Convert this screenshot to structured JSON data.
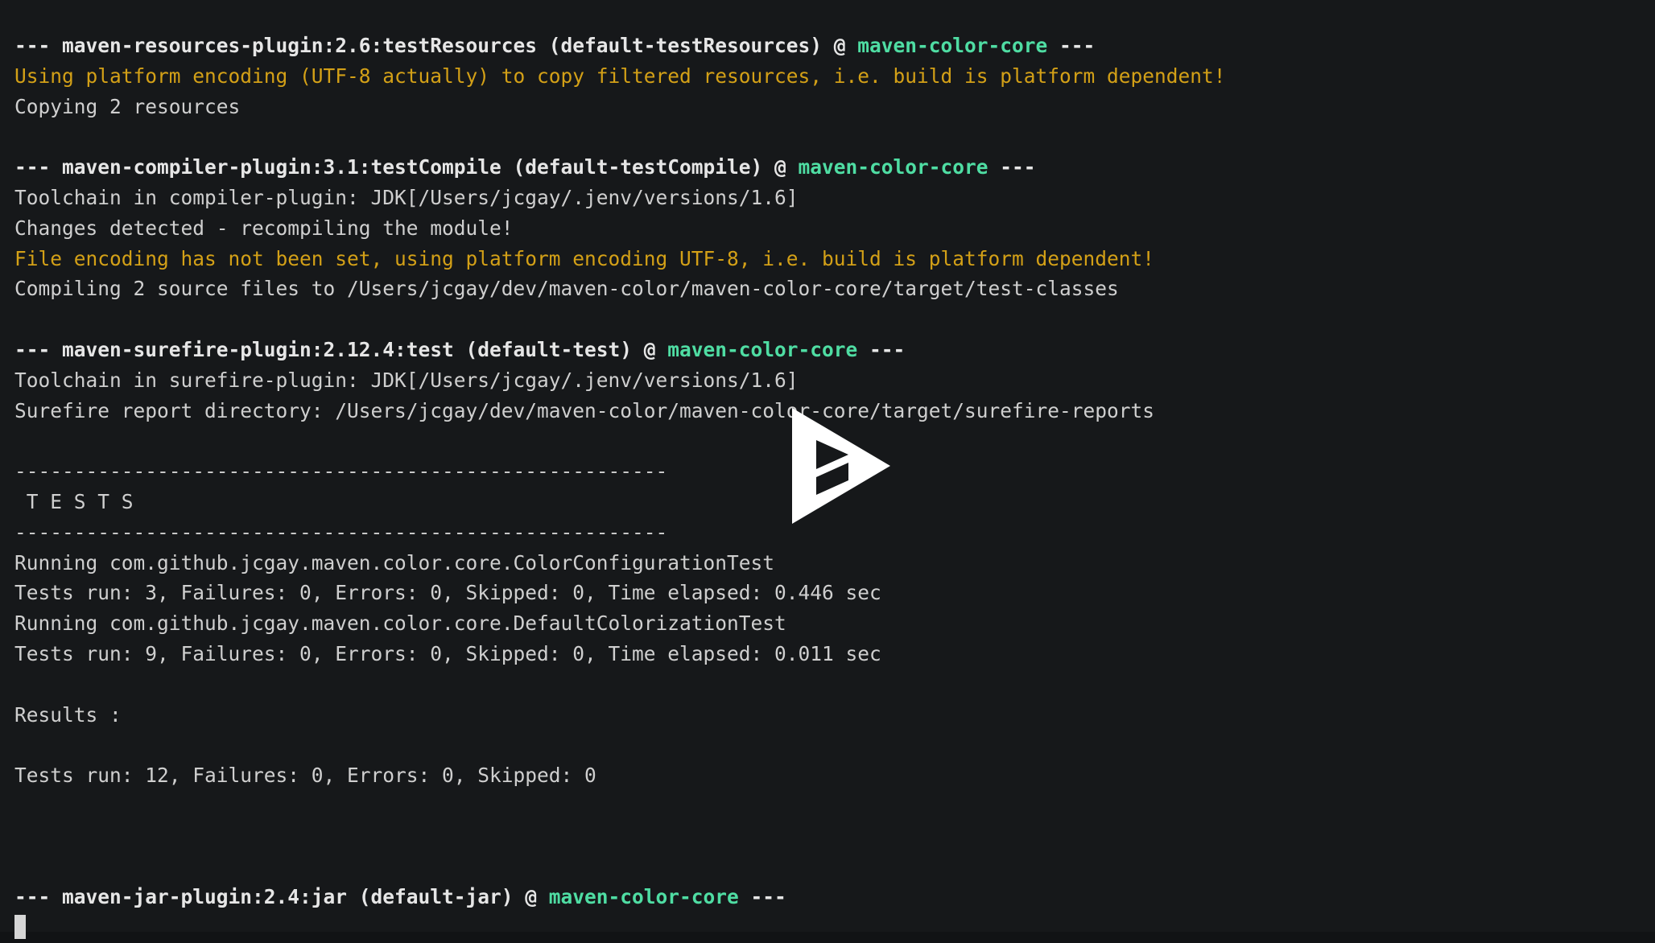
{
  "terminal": {
    "background_color": "#16181a",
    "default_text_color": "#cfcfcf",
    "warning_color": "#d3a017",
    "project_color": "#4fdda3",
    "cursor_color": "#d6d6d6",
    "lines": [
      {
        "id": "l01",
        "segments": [
          {
            "text": "--- maven-resources-plugin:2.6:testResources (default-testResources) @ ",
            "style": "bold"
          },
          {
            "text": "maven-color-core",
            "style": "project"
          },
          {
            "text": " ---",
            "style": "bold"
          }
        ]
      },
      {
        "id": "l02",
        "segments": [
          {
            "text": "Using platform encoding (UTF-8 actually) to copy filtered resources, i.e. build is platform dependent!",
            "style": "warn"
          }
        ]
      },
      {
        "id": "l03",
        "segments": [
          {
            "text": "Copying 2 resources",
            "style": "plain"
          }
        ]
      },
      {
        "id": "l04",
        "segments": [
          {
            "text": "",
            "style": "plain"
          }
        ]
      },
      {
        "id": "l05",
        "segments": [
          {
            "text": "--- maven-compiler-plugin:3.1:testCompile (default-testCompile) @ ",
            "style": "bold"
          },
          {
            "text": "maven-color-core",
            "style": "project"
          },
          {
            "text": " ---",
            "style": "bold"
          }
        ]
      },
      {
        "id": "l06",
        "segments": [
          {
            "text": "Toolchain in compiler-plugin: JDK[/Users/jcgay/.jenv/versions/1.6]",
            "style": "plain"
          }
        ]
      },
      {
        "id": "l07",
        "segments": [
          {
            "text": "Changes detected - recompiling the module!",
            "style": "plain"
          }
        ]
      },
      {
        "id": "l08",
        "segments": [
          {
            "text": "File encoding has not been set, using platform encoding UTF-8, i.e. build is platform dependent!",
            "style": "warn"
          }
        ]
      },
      {
        "id": "l09",
        "segments": [
          {
            "text": "Compiling 2 source files to /Users/jcgay/dev/maven-color/maven-color-core/target/test-classes",
            "style": "plain"
          }
        ]
      },
      {
        "id": "l10",
        "segments": [
          {
            "text": "",
            "style": "plain"
          }
        ]
      },
      {
        "id": "l11",
        "segments": [
          {
            "text": "--- maven-surefire-plugin:2.12.4:test (default-test) @ ",
            "style": "bold"
          },
          {
            "text": "maven-color-core",
            "style": "project"
          },
          {
            "text": " ---",
            "style": "bold"
          }
        ]
      },
      {
        "id": "l12",
        "segments": [
          {
            "text": "Toolchain in surefire-plugin: JDK[/Users/jcgay/.jenv/versions/1.6]",
            "style": "plain"
          }
        ]
      },
      {
        "id": "l13",
        "segments": [
          {
            "text": "Surefire report directory: /Users/jcgay/dev/maven-color/maven-color-core/target/surefire-reports",
            "style": "plain"
          }
        ]
      },
      {
        "id": "l14",
        "segments": [
          {
            "text": "",
            "style": "plain"
          }
        ]
      },
      {
        "id": "l15",
        "segments": [
          {
            "text": "-------------------------------------------------------",
            "style": "rule"
          }
        ]
      },
      {
        "id": "l16",
        "segments": [
          {
            "text": " T E S T S",
            "style": "plain"
          }
        ]
      },
      {
        "id": "l17",
        "segments": [
          {
            "text": "-------------------------------------------------------",
            "style": "rule"
          }
        ]
      },
      {
        "id": "l18",
        "segments": [
          {
            "text": "Running com.github.jcgay.maven.color.core.ColorConfigurationTest",
            "style": "plain"
          }
        ]
      },
      {
        "id": "l19",
        "segments": [
          {
            "text": "Tests run: 3, Failures: 0, Errors: 0, Skipped: 0, Time elapsed: 0.446 sec",
            "style": "plain"
          }
        ]
      },
      {
        "id": "l20",
        "segments": [
          {
            "text": "Running com.github.jcgay.maven.color.core.DefaultColorizationTest",
            "style": "plain"
          }
        ]
      },
      {
        "id": "l21",
        "segments": [
          {
            "text": "Tests run: 9, Failures: 0, Errors: 0, Skipped: 0, Time elapsed: 0.011 sec",
            "style": "plain"
          }
        ]
      },
      {
        "id": "l22",
        "segments": [
          {
            "text": "",
            "style": "plain"
          }
        ]
      },
      {
        "id": "l23",
        "segments": [
          {
            "text": "Results :",
            "style": "plain"
          }
        ]
      },
      {
        "id": "l24",
        "segments": [
          {
            "text": "",
            "style": "plain"
          }
        ]
      },
      {
        "id": "l25",
        "segments": [
          {
            "text": "Tests run: 12, Failures: 0, Errors: 0, Skipped: 0",
            "style": "plain"
          }
        ]
      },
      {
        "id": "l26",
        "segments": [
          {
            "text": "",
            "style": "plain"
          }
        ]
      },
      {
        "id": "l27",
        "segments": [
          {
            "text": "",
            "style": "plain"
          }
        ]
      },
      {
        "id": "l28",
        "segments": [
          {
            "text": "",
            "style": "plain"
          }
        ]
      },
      {
        "id": "l29",
        "segments": [
          {
            "text": "--- maven-jar-plugin:2.4:jar (default-jar) @ ",
            "style": "bold"
          },
          {
            "text": "maven-color-core",
            "style": "project"
          },
          {
            "text": " ---",
            "style": "bold"
          }
        ]
      },
      {
        "id": "l30",
        "segments": [
          {
            "text": "",
            "style": "cursor"
          }
        ]
      }
    ]
  },
  "overlay": {
    "play_button": {
      "label": "Play",
      "icon": "play-triangle-icon",
      "color": "#ffffff"
    }
  }
}
